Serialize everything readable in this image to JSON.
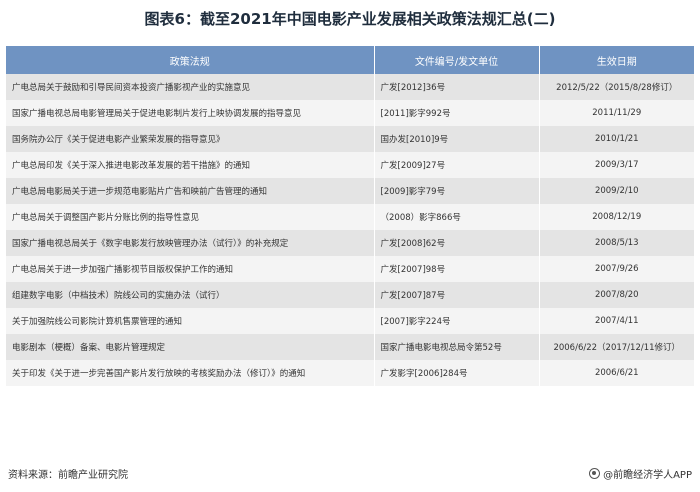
{
  "title": "图表6：截至2021年中国电影产业发展相关政策法规汇总(二)",
  "table": {
    "headers": [
      "政策法规",
      "文件编号/发文单位",
      "生效日期"
    ],
    "rows": [
      {
        "policy": "广电总局关于鼓励和引导民间资本投资广播影视产业的实施意见",
        "doc": "广发[2012]36号",
        "date": "2012/5/22（2015/8/28修订）"
      },
      {
        "policy": "国家广播电视总局电影管理局关于促进电影制片发行上映协调发展的指导意见",
        "doc": "[2011]影字992号",
        "date": "2011/11/29"
      },
      {
        "policy": "国务院办公厅《关于促进电影产业繁荣发展的指导意见》",
        "doc": "国办发[2010]9号",
        "date": "2010/1/21"
      },
      {
        "policy": "广电总局印发《关于深入推进电影改革发展的若干措施》的通知",
        "doc": "广发[2009]27号",
        "date": "2009/3/17"
      },
      {
        "policy": "广电总局电影局关于进一步规范电影贴片广告和映前广告管理的通知",
        "doc": "[2009]影字79号",
        "date": "2009/2/10"
      },
      {
        "policy": "广电总局关于调整国产影片分账比例的指导性意见",
        "doc": "（2008）影字866号",
        "date": "2008/12/19"
      },
      {
        "policy": "国家广播电视总局关于《数字电影发行放映管理办法（试行）》的补充规定",
        "doc": "广发[2008]62号",
        "date": "2008/5/13"
      },
      {
        "policy": "广电总局关于进一步加强广播影视节目版权保护工作的通知",
        "doc": "广发[2007]98号",
        "date": "2007/9/26"
      },
      {
        "policy": "组建数字电影（中档技术）院线公司的实施办法（试行）",
        "doc": "广发[2007]87号",
        "date": "2007/8/20"
      },
      {
        "policy": "关于加强院线公司影院计算机售票管理的通知",
        "doc": "[2007]影字224号",
        "date": "2007/4/11"
      },
      {
        "policy": "电影剧本（梗概）备案、电影片管理规定",
        "doc": "国家广播电影电视总局令第52号",
        "date": "2006/6/22（2017/12/11修订）"
      },
      {
        "policy": "关于印发《关于进一步完善国产影片发行放映的考核奖励办法（修订）》的通知",
        "doc": "广发影字[2006]284号",
        "date": "2006/6/21"
      }
    ]
  },
  "footer": {
    "source": "资料来源：前瞻产业研究院",
    "brand": "@前瞻经济学人APP",
    "brand_icon": "qianzhan-logo-icon"
  },
  "colors": {
    "header_bg": "#6f93c2",
    "row_odd": "#e4e4e4",
    "row_even": "#f4f4f4"
  }
}
